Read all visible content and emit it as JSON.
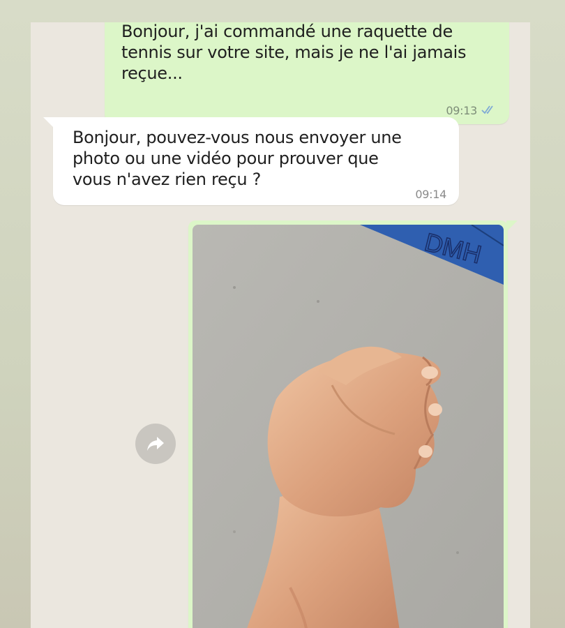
{
  "conversation": {
    "sent_message": {
      "text": "Bonjour, j'ai commandé une raquette de tennis sur votre site, mais je ne l'ai jamais reçue...",
      "time": "09:13",
      "status_icon": "double-check-icon"
    },
    "received_message": {
      "text": "Bonjour, pouvez-vous nous envoyer une photo ou une vidéo pour prouver que vous n'avez rien reçu ?",
      "time": "09:14"
    },
    "photo_message": {
      "watermark": "DMH",
      "description_icon": "forward-icon"
    }
  },
  "colors": {
    "sent_bubble": "#dcf6c8",
    "received_bubble": "#ffffff",
    "chat_background": "#ebe7df",
    "read_ticks": "#7fa9d6"
  }
}
